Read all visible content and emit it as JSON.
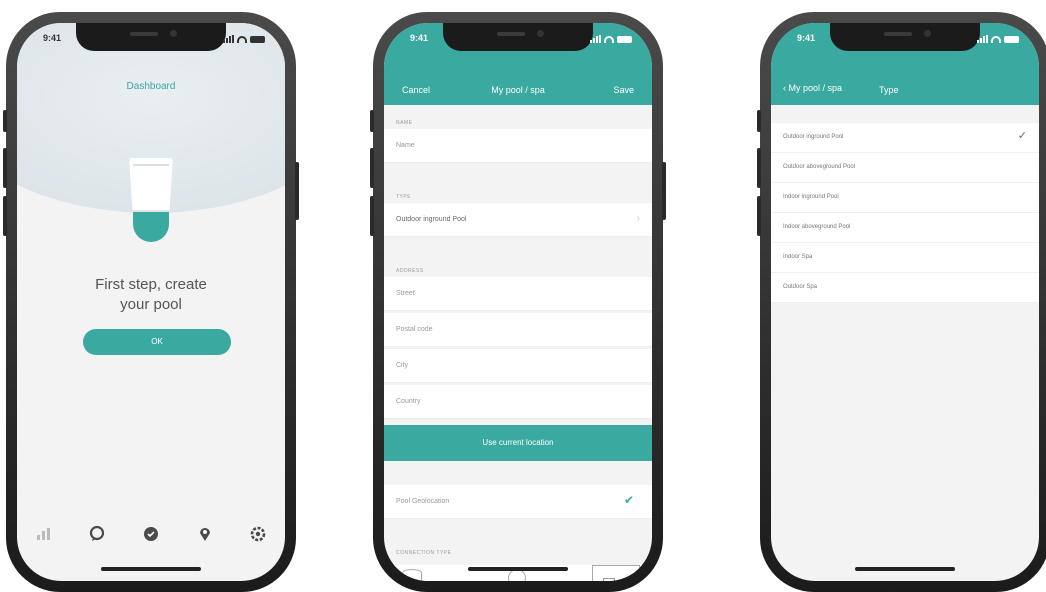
{
  "accent_color": "#3aa99f",
  "status": {
    "time": "9:41"
  },
  "phone1": {
    "nav_title": "Dashboard",
    "headline_line1": "First step, create",
    "headline_line2": "your pool",
    "ok_label": "OK",
    "tabs": [
      {
        "icon": "chart-icon"
      },
      {
        "icon": "chat-icon"
      },
      {
        "icon": "badge-icon"
      },
      {
        "icon": "location-pin-icon"
      },
      {
        "icon": "gear-icon"
      }
    ]
  },
  "phone2": {
    "cancel_label": "Cancel",
    "title": "My pool / spa",
    "save_label": "Save",
    "name_header": "NAME",
    "name_placeholder": "Name",
    "type_header": "TYPE",
    "type_value": "Outdoor inground Pool",
    "address_header": "ADDRESS",
    "street_placeholder": "Street",
    "postal_placeholder": "Postal code",
    "city_placeholder": "City",
    "country_placeholder": "Country",
    "use_location_label": "Use current location",
    "geo_label": "Pool Geolocation",
    "connection_header": "CONNECTION TYPE"
  },
  "phone3": {
    "back_label": "My pool / spa",
    "title": "Type",
    "options": [
      {
        "label": "Outdoor inground Pool",
        "selected": true
      },
      {
        "label": "Outdoor aboveground Pool",
        "selected": false
      },
      {
        "label": "Indoor inground Pool",
        "selected": false
      },
      {
        "label": "Indoor aboveground Pool",
        "selected": false
      },
      {
        "label": "Indoor Spa",
        "selected": false
      },
      {
        "label": "Outdoor Spa",
        "selected": false
      }
    ]
  }
}
